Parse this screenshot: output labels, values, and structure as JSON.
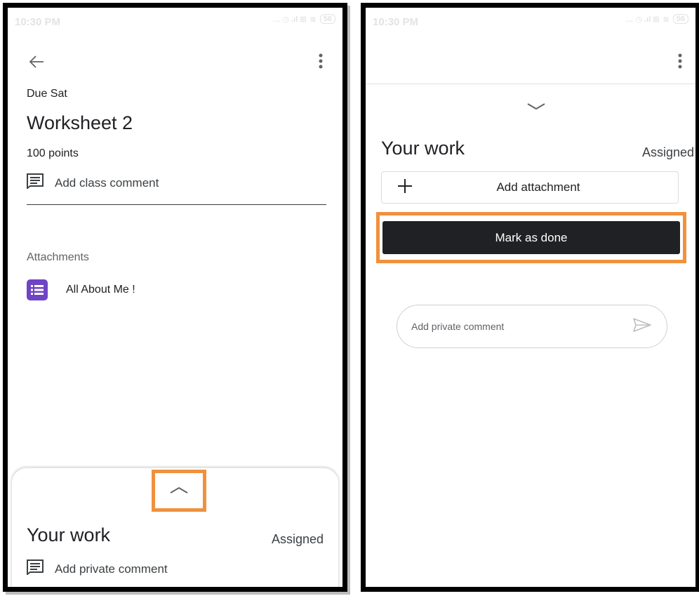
{
  "left": {
    "status": {
      "time": "10:30 PM",
      "battery": "56"
    },
    "due": "Due Sat",
    "title": "Worksheet 2",
    "points": "100 points",
    "class_comment": "Add class comment",
    "attachments_heading": "Attachments",
    "attachment_name": "All About Me !",
    "your_work": "Your work",
    "status_label": "Assigned",
    "private_comment": "Add private comment"
  },
  "right": {
    "status": {
      "time": "10:30 PM",
      "battery": "56"
    },
    "your_work": "Your work",
    "status_label": "Assigned",
    "add_attachment": "Add attachment",
    "mark_done": "Mark as done",
    "private_comment_placeholder": "Add private comment"
  },
  "colors": {
    "highlight": "#f0913d",
    "forms_purple": "#6e45c5",
    "primary_button": "#202124"
  },
  "icons": [
    "back-arrow-icon",
    "more-vert-icon",
    "comment-icon",
    "forms-icon",
    "chevron-up-icon",
    "chevron-down-icon",
    "plus-icon",
    "send-icon"
  ]
}
